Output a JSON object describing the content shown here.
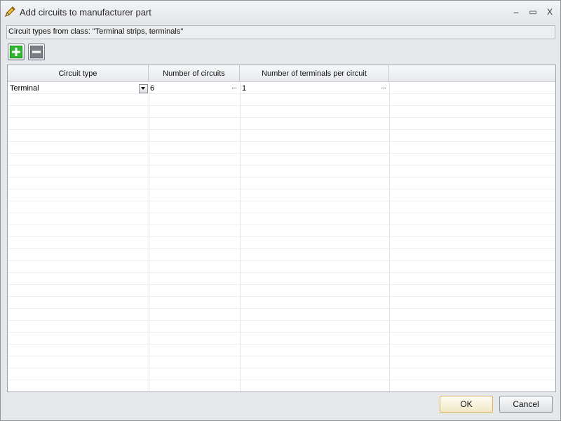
{
  "window": {
    "title": "Add circuits to manufacturer part",
    "minimize_glyph": "–",
    "maximize_glyph": "▭",
    "close_glyph": "X"
  },
  "info": {
    "text": "Circuit types from class: \"Terminal strips, terminals\""
  },
  "toolbar": {
    "add_icon": "plus-icon",
    "remove_icon": "minus-icon",
    "add_color": "#2fb52f",
    "remove_color": "#7c8086"
  },
  "grid": {
    "columns": [
      "Circuit type",
      "Number of circuits",
      "Number of terminals per circuit",
      ""
    ],
    "rows": [
      {
        "circuit_type": "Terminal",
        "number_of_circuits": "6",
        "terminals_per_circuit": "1"
      }
    ],
    "ellipsis": "···"
  },
  "buttons": {
    "ok": "OK",
    "cancel": "Cancel"
  }
}
